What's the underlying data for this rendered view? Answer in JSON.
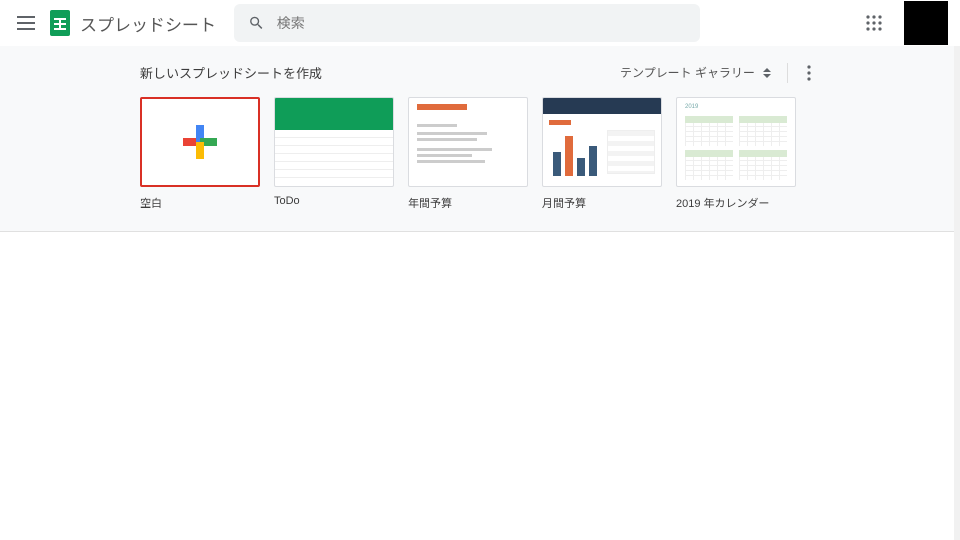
{
  "header": {
    "app_name": "スプレッドシート",
    "search_placeholder": "検索"
  },
  "template_strip": {
    "title": "新しいスプレッドシートを作成",
    "gallery_label": "テンプレート ギャラリー",
    "templates": [
      {
        "label": "空白"
      },
      {
        "label": "ToDo"
      },
      {
        "label": "年間予算"
      },
      {
        "label": "月間予算"
      },
      {
        "label": "2019 年カレンダー"
      }
    ]
  },
  "colors": {
    "brand_green": "#0f9d58",
    "accent_red": "#d93025"
  }
}
